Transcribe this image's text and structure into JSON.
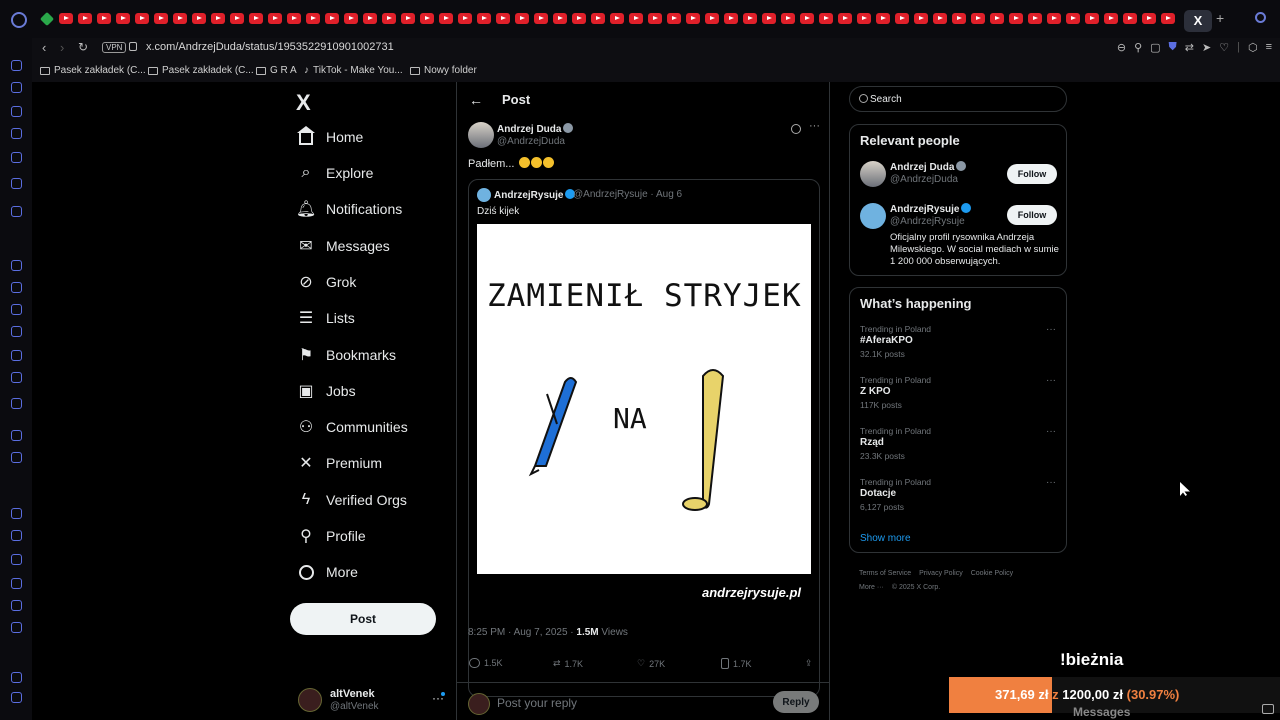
{
  "browser": {
    "url": "x.com/AndrzejDuda/status/1953522910901002731",
    "vpn_label": "VPN",
    "active_tab_label": "X",
    "bookmarks": [
      {
        "label": "Pasek zakładek (C..."
      },
      {
        "label": "Pasek zakładek (C..."
      },
      {
        "label": "G R A"
      },
      {
        "label": "TikTok - Make You..."
      },
      {
        "label": "Nowy folder"
      }
    ]
  },
  "nav": {
    "logo": "X",
    "items": [
      {
        "label": "Home",
        "icon": "home-icon"
      },
      {
        "label": "Explore",
        "icon": "search-icon"
      },
      {
        "label": "Notifications",
        "icon": "bell-icon"
      },
      {
        "label": "Messages",
        "icon": "envelope-icon"
      },
      {
        "label": "Grok",
        "icon": "grok-icon"
      },
      {
        "label": "Lists",
        "icon": "list-icon"
      },
      {
        "label": "Bookmarks",
        "icon": "bookmark-icon"
      },
      {
        "label": "Jobs",
        "icon": "briefcase-icon"
      },
      {
        "label": "Communities",
        "icon": "people-icon"
      },
      {
        "label": "Premium",
        "icon": "x-icon"
      },
      {
        "label": "Verified Orgs",
        "icon": "lightning-icon"
      },
      {
        "label": "Profile",
        "icon": "person-icon"
      },
      {
        "label": "More",
        "icon": "more-circle-icon"
      }
    ],
    "post_button": "Post",
    "account": {
      "name": "altVenek",
      "handle": "@altVenek"
    }
  },
  "post": {
    "header_title": "Post",
    "author_name": "Andrzej Duda",
    "author_handle": "@AndrzejDuda",
    "text": "Padłem...",
    "quote": {
      "author_name": "AndrzejRysuje",
      "meta": "@AndrzejRysuje · Aug 6",
      "text": "Dziś kijek",
      "image_line1": "ZAMIENIŁ STRYJEK",
      "image_line2": "NA",
      "image_signature": "andrzejrysuje.pl"
    },
    "timestamp": "8:25 PM · Aug 7, 2025 · ",
    "views_count": "1.5M",
    "views_label": " Views",
    "stats": {
      "replies": "1.5K",
      "reposts": "1.7K",
      "likes": "27K",
      "bookmarks": "1.7K"
    },
    "reply_placeholder": "Post your reply",
    "reply_button": "Reply"
  },
  "right": {
    "search_placeholder": "Search",
    "relevant_title": "Relevant people",
    "people": [
      {
        "name": "Andrzej Duda",
        "handle": "@AndrzejDuda",
        "button": "Follow",
        "bio": ""
      },
      {
        "name": "AndrzejRysuje",
        "handle": "@AndrzejRysuje",
        "button": "Follow",
        "bio": "Oficjalny profil rysownika Andrzeja Milewskiego. W social mediach w sumie 1 200 000 obserwujących."
      }
    ],
    "happening_title": "What’s happening",
    "trends": [
      {
        "context": "Trending in Poland",
        "name": "#AferaKPO",
        "posts": "32.1K posts"
      },
      {
        "context": "Trending in Poland",
        "name": "Z KPO",
        "posts": "117K posts"
      },
      {
        "context": "Trending in Poland",
        "name": "Rząd",
        "posts": "23.3K posts"
      },
      {
        "context": "Trending in Poland",
        "name": "Dotacje",
        "posts": "6,127 posts"
      }
    ],
    "show_more": "Show more",
    "footer": {
      "terms": "Terms of Service",
      "privacy": "Privacy Policy",
      "cookie": "Cookie Policy",
      "more": "More ···",
      "copyright": "© 2025 X Corp."
    }
  },
  "overlay": {
    "title": "!bieżnia",
    "current": "371,69",
    "currency1": "zł",
    "z_word": "z",
    "goal": "1200,00",
    "currency2": "zł",
    "percent": "(30.97%)",
    "progress_fraction": 0.3097,
    "messages_label": "Messages"
  }
}
